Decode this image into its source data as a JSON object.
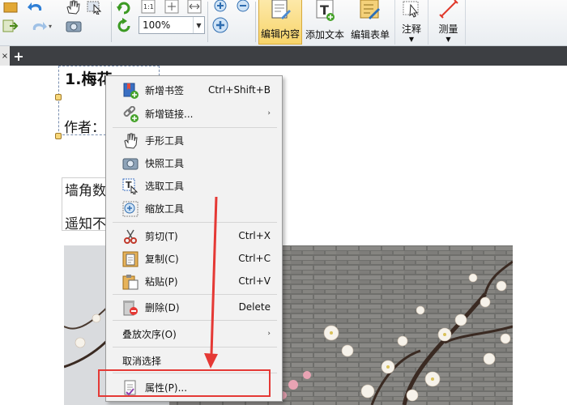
{
  "toolbar": {
    "zoom_value": "100%",
    "page_num_label": "1:1",
    "buttons": {
      "edit_content": "编辑内容",
      "add_text": "添加文本",
      "edit_form": "编辑表单",
      "annotate": "注释",
      "measure": "测量"
    }
  },
  "tabbar": {
    "close_glyph": "×",
    "new_tab_glyph": "+"
  },
  "document": {
    "title": "1.梅花",
    "author_label": "作者：",
    "poem_lines": [
      "墙角数",
      "遥知不"
    ]
  },
  "context_menu": {
    "items": [
      {
        "label": "新增书签",
        "shortcut": "Ctrl+Shift+B",
        "icon": "bookmark-add-icon"
      },
      {
        "label": "新增链接...",
        "submenu": "›",
        "icon": "link-add-icon"
      },
      {
        "label": "手形工具",
        "icon": "hand-tool-icon"
      },
      {
        "label": "快照工具",
        "icon": "camera-icon"
      },
      {
        "label": "选取工具",
        "icon": "select-text-icon"
      },
      {
        "label": "缩放工具",
        "icon": "zoom-icon"
      },
      {
        "label": "剪切(T)",
        "shortcut": "Ctrl+X",
        "icon": "scissors-icon"
      },
      {
        "label": "复制(C)",
        "shortcut": "Ctrl+C",
        "icon": "copy-icon"
      },
      {
        "label": "粘贴(P)",
        "shortcut": "Ctrl+V",
        "icon": "paste-icon"
      },
      {
        "label": "删除(D)",
        "shortcut": "Delete",
        "icon": "delete-icon"
      },
      {
        "label": "叠放次序(O)",
        "submenu": "›"
      },
      {
        "label": "取消选择"
      },
      {
        "label": "属性(P)...",
        "icon": "properties-icon"
      }
    ]
  },
  "annotation": {
    "arrow_color": "#e53935",
    "highlight_color": "#e53935"
  },
  "colors": {
    "active_button": "#f7d46a",
    "tab_bar": "#3d3f43",
    "menu_bg": "#f2f2f2"
  }
}
